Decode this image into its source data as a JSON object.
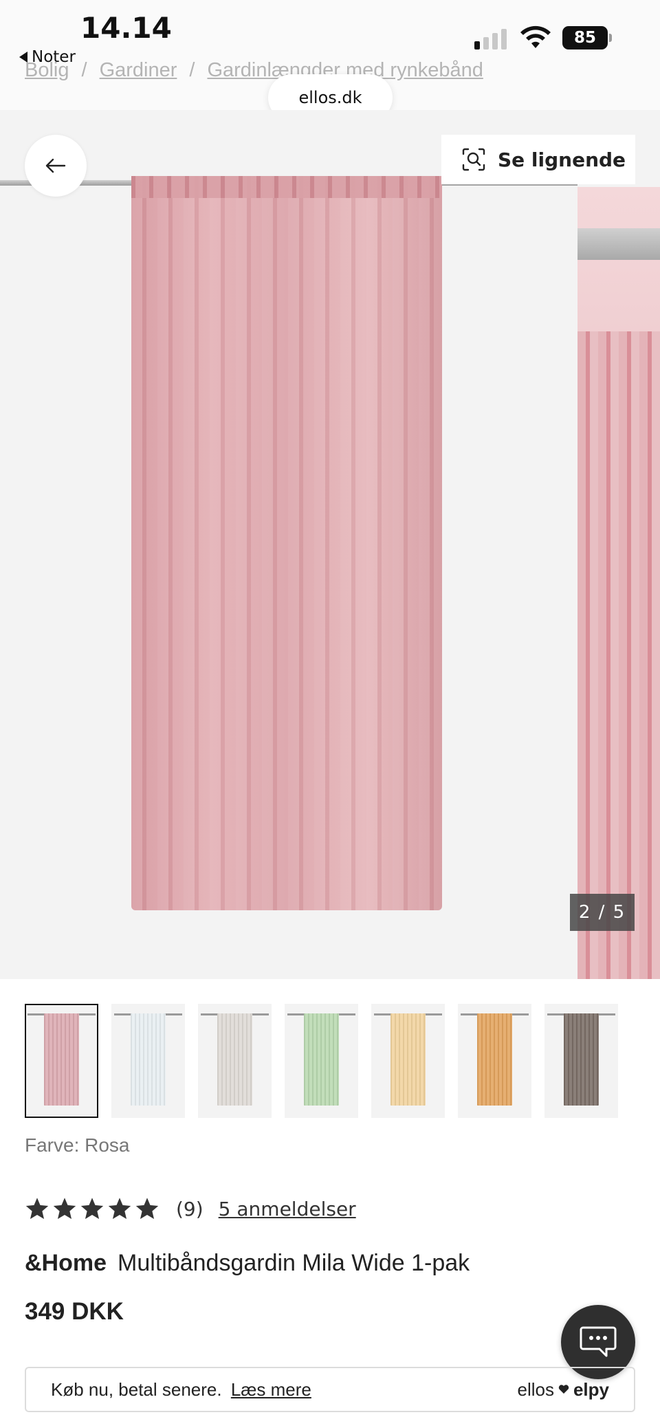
{
  "status_bar": {
    "time": "14.14",
    "back_app": "Noter",
    "battery": "85"
  },
  "breadcrumb": {
    "items": [
      "Bolig",
      "Gardiner",
      "Gardinlængder med rynkebånd"
    ],
    "separator": "/"
  },
  "browser": {
    "url": "ellos.dk"
  },
  "gallery": {
    "see_similar": "Se lignende",
    "counter": "2 / 5",
    "current_image": 2,
    "total_images": 5
  },
  "thumbnails": [
    {
      "color": "#dcaab0",
      "selected": true
    },
    {
      "color": "#e7eef1",
      "selected": false
    },
    {
      "color": "#dedad5",
      "selected": false
    },
    {
      "color": "#b9d9b0",
      "selected": false
    },
    {
      "color": "#f1d39e",
      "selected": false
    },
    {
      "color": "#e3a45e",
      "selected": false
    },
    {
      "color": "#7a6d66",
      "selected": false
    }
  ],
  "product": {
    "color_label": "Farve: Rosa",
    "rating_stars": 5,
    "rating_count": "(9)",
    "reviews_link": "5 anmeldelser",
    "brand": "&Home",
    "name": "Multibåndsgardin Mila Wide 1-pak",
    "price": "349 DKK"
  },
  "payment": {
    "text": "Køb nu, betal senere.",
    "link": "Læs mere",
    "brand_left": "ellos",
    "brand_right": "elpy"
  },
  "icons": {
    "back": "arrow-left-icon",
    "similar": "visual-search-icon",
    "chat": "chat-icon",
    "heart": "heart-icon"
  }
}
